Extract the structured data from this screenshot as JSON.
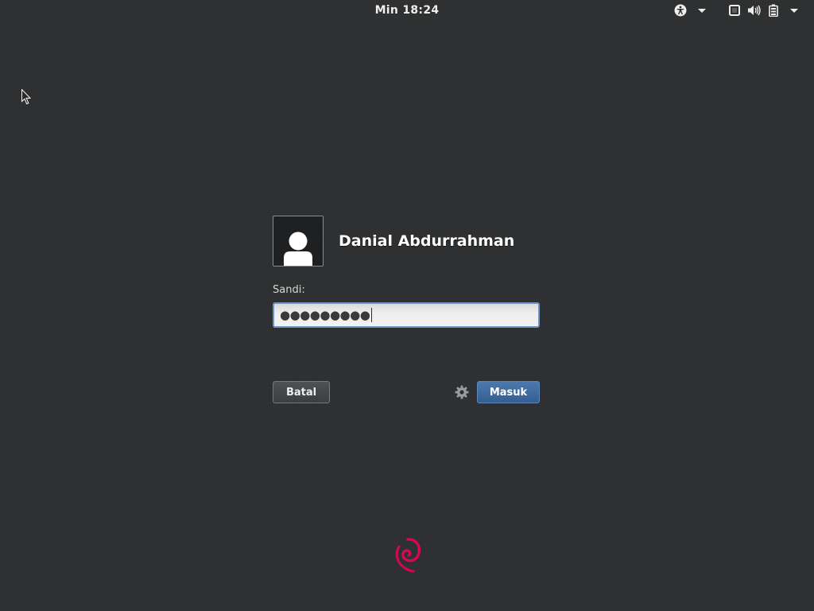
{
  "topbar": {
    "clock": "Min 18:24",
    "icons": [
      "accessibility-icon",
      "screen-icon",
      "volume-icon",
      "battery-icon"
    ]
  },
  "login": {
    "user_name": "Danial Abdurrahman",
    "prompt_label": "Sandi:",
    "password_masked": "●●●●●●●●●",
    "cancel_label": "Batal",
    "submit_label": "Masuk"
  },
  "colors": {
    "background": "#2d2f30",
    "accent": "#4a75aa",
    "focus_ring": "#6d94c7",
    "debian_red": "#d70751"
  }
}
